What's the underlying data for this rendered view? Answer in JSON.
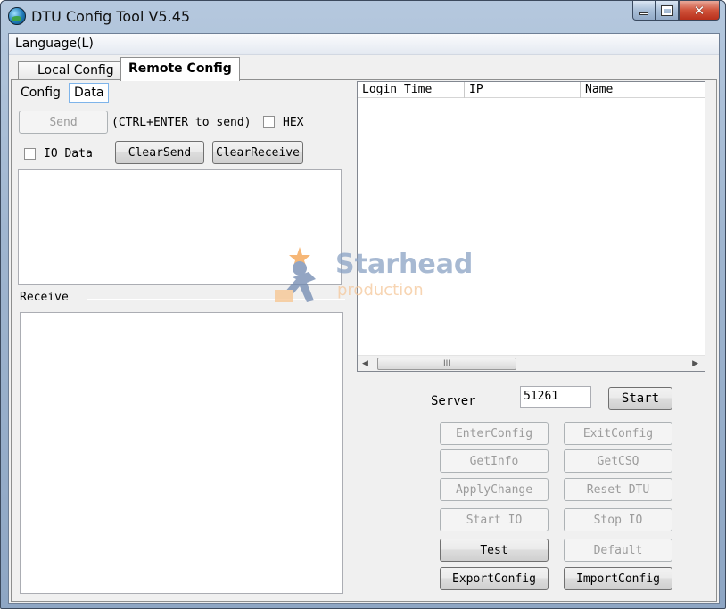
{
  "window": {
    "title": "DTU Config Tool V5.45"
  },
  "menu": {
    "language": "Language(L)"
  },
  "tabs": [
    {
      "label": "Local Config"
    },
    {
      "label": "Remote Config"
    }
  ],
  "subtabs": {
    "config": "Config",
    "data": "Data"
  },
  "send": {
    "button": "Send",
    "hint": "(CTRL+ENTER to send)",
    "hex_label": "HEX",
    "hex_checked": false,
    "io_label": "IO Data",
    "io_checked": false,
    "clear_send": "ClearSend",
    "clear_receive": "ClearReceive",
    "text": ""
  },
  "receive": {
    "label": "Receive",
    "text": ""
  },
  "table": {
    "columns": [
      "Login Time",
      "IP",
      "Name"
    ],
    "rows": [],
    "scroll_thumb": "III"
  },
  "server": {
    "label": "Server",
    "port": "51261",
    "start": "Start"
  },
  "actions": {
    "enter_config": "EnterConfig",
    "exit_config": "ExitConfig",
    "get_info": "GetInfo",
    "get_csq": "GetCSQ",
    "apply_change": "ApplyChange",
    "reset_dtu": "Reset DTU",
    "start_io": "Start IO",
    "stop_io": "Stop IO",
    "test": "Test",
    "default": "Default",
    "export_config": "ExportConfig",
    "import_config": "ImportConfig"
  },
  "watermark": {
    "title": "Starhead",
    "subtitle": "production"
  }
}
